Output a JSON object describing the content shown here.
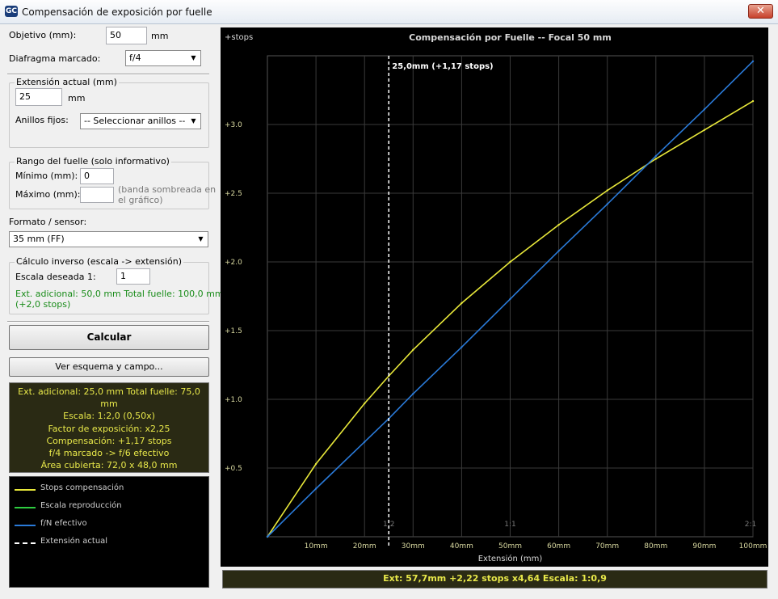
{
  "window": {
    "title": "Compensación de exposición por fuelle",
    "close": "✕",
    "icon_label": "GC"
  },
  "form": {
    "objetivo_label": "Objetivo (mm):",
    "objetivo_value": "50",
    "objetivo_unit": "mm",
    "diafragma_label": "Diafragma marcado:",
    "diafragma_value": "f/4",
    "extension_group": "Extensión actual (mm)",
    "extension_value": "25",
    "extension_unit": "mm",
    "anillos_label": "Anillos fijos:",
    "anillos_value": "-- Seleccionar anillos --",
    "rango_group": "Rango del fuelle (solo informativo)",
    "minimo_label": "Mínimo (mm):",
    "minimo_value": "0",
    "maximo_label": "Máximo (mm):",
    "maximo_value": "",
    "maximo_note_1": "(banda sombreada en",
    "maximo_note_2": "el gráfico)",
    "formato_label": "Formato / sensor:",
    "formato_value": "35 mm (FF)",
    "calculo_group": "Cálculo inverso (escala -> extensión)",
    "escala_label": "Escala deseada  1:",
    "escala_value": "1",
    "calc_result_1": "Ext. adicional: 50,0 mm   Total fuelle: 100,0 mm",
    "calc_result_2": "(+2,0 stops)",
    "calcular_button": "Calcular",
    "esquema_button": "Ver esquema y campo..."
  },
  "results": [
    "Ext. adicional: 25,0 mm   Total fuelle: 75,0 mm",
    "Escala:  1:2,0  (0,50x)",
    "Factor de exposición:  x2,25",
    "Compensación:  +1,17 stops",
    "f/4 marcado  ->  f/6 efectivo",
    "Área cubierta: 72,0 x 48,0 mm"
  ],
  "legend": [
    {
      "label": "Stops compensación",
      "color": "#e8e83a",
      "dashed": false
    },
    {
      "label": "Escala reproducción",
      "color": "#2ecc40",
      "dashed": false
    },
    {
      "label": "f/N efectivo",
      "color": "#2a7ad8",
      "dashed": false
    },
    {
      "label": "Extensión actual",
      "color": "#ffffff",
      "dashed": true
    }
  ],
  "status": "Ext: 57,7mm    +2,22 stops    x4,64    Escala: 1:0,9",
  "chart_data": {
    "type": "line",
    "title": "Compensación por Fuelle  --  Focal 50 mm",
    "ylabel": "+stops",
    "xlabel": "Extensión (mm)",
    "xlim": [
      0,
      100
    ],
    "ylim": [
      0,
      3.5
    ],
    "x_ticks": [
      10,
      20,
      30,
      40,
      50,
      60,
      70,
      80,
      90,
      100
    ],
    "x_tick_labels": [
      "10mm",
      "20mm",
      "30mm",
      "40mm",
      "50mm",
      "60mm",
      "70mm",
      "80mm",
      "90mm",
      "100mm"
    ],
    "y_ticks": [
      0.5,
      1.0,
      1.5,
      2.0,
      2.5,
      3.0
    ],
    "y_tick_labels": [
      "+0.5",
      "+1.0",
      "+1.5",
      "+2.0",
      "+2.5",
      "+3.0"
    ],
    "scale_marks": [
      {
        "label": "1:2",
        "x": 25
      },
      {
        "label": "1:1",
        "x": 50
      },
      {
        "label": "2:1",
        "x": 100
      }
    ],
    "current_extension": {
      "x": 25,
      "label": "25,0mm  (+1,17 stops)"
    },
    "colors": {
      "stops": "#e8e83a",
      "fn": "#2a7ad8",
      "grid": "#3a3a3a",
      "text": "#d8d8a0"
    },
    "series": [
      {
        "name": "Stops compensación",
        "x": [
          0,
          10,
          20,
          25,
          30,
          40,
          50,
          60,
          70,
          80,
          90,
          100
        ],
        "values": [
          0,
          0.53,
          0.97,
          1.17,
          1.36,
          1.7,
          2.0,
          2.27,
          2.52,
          2.75,
          2.96,
          3.17
        ]
      },
      {
        "name": "f/N efectivo",
        "x": [
          0,
          10,
          20,
          25,
          30,
          40,
          50,
          60,
          70,
          80,
          90,
          100
        ],
        "values": [
          0,
          0.35,
          0.69,
          0.86,
          1.04,
          1.38,
          1.73,
          2.08,
          2.42,
          2.77,
          3.11,
          3.46
        ]
      }
    ]
  }
}
